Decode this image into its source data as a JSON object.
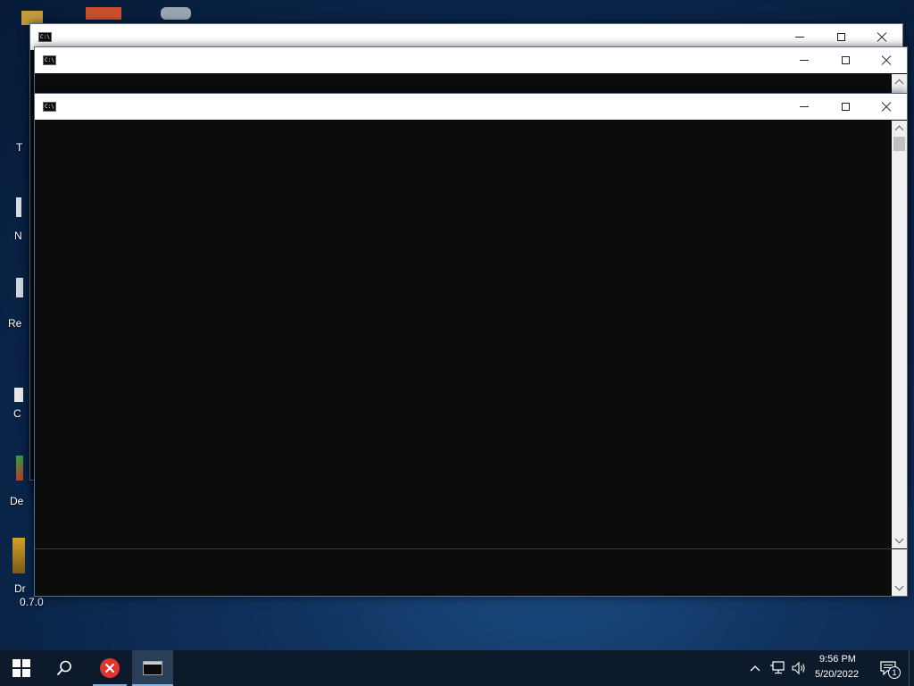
{
  "desktop": {
    "icons": [
      {
        "name": "desktop-icon-1",
        "label": "T"
      },
      {
        "name": "desktop-icon-2",
        "label": "N"
      },
      {
        "name": "desktop-icon-3",
        "label": "Re"
      },
      {
        "name": "desktop-icon-4",
        "label": "C"
      },
      {
        "name": "desktop-icon-5",
        "label": "De"
      },
      {
        "name": "desktop-icon-6",
        "label": "Dr"
      },
      {
        "name": "desktop-icon-6-sub",
        "label": "0.7.0"
      }
    ]
  },
  "windows": [
    {
      "title": "",
      "icon": "cmd-icon"
    },
    {
      "title": "",
      "icon": "cmd-icon"
    },
    {
      "title": "",
      "icon": "cmd-icon"
    }
  ],
  "cmd_glyph_text": "C:\\",
  "colors": {
    "console_bg": "#0c0c0c",
    "titlebar_bg": "#ffffff",
    "taskbar_bg": "#0c1a2c",
    "error_red": "#e0342f"
  },
  "taskbar": {
    "start_icon": "windows-start-icon",
    "search_icon": "search-icon",
    "pinned": [
      {
        "name": "error-app-icon"
      },
      {
        "name": "cmd-taskbar-icon",
        "active": true
      }
    ],
    "tray": {
      "time": "9:56 PM",
      "date": "5/20/2022",
      "notification_count": "1"
    }
  }
}
